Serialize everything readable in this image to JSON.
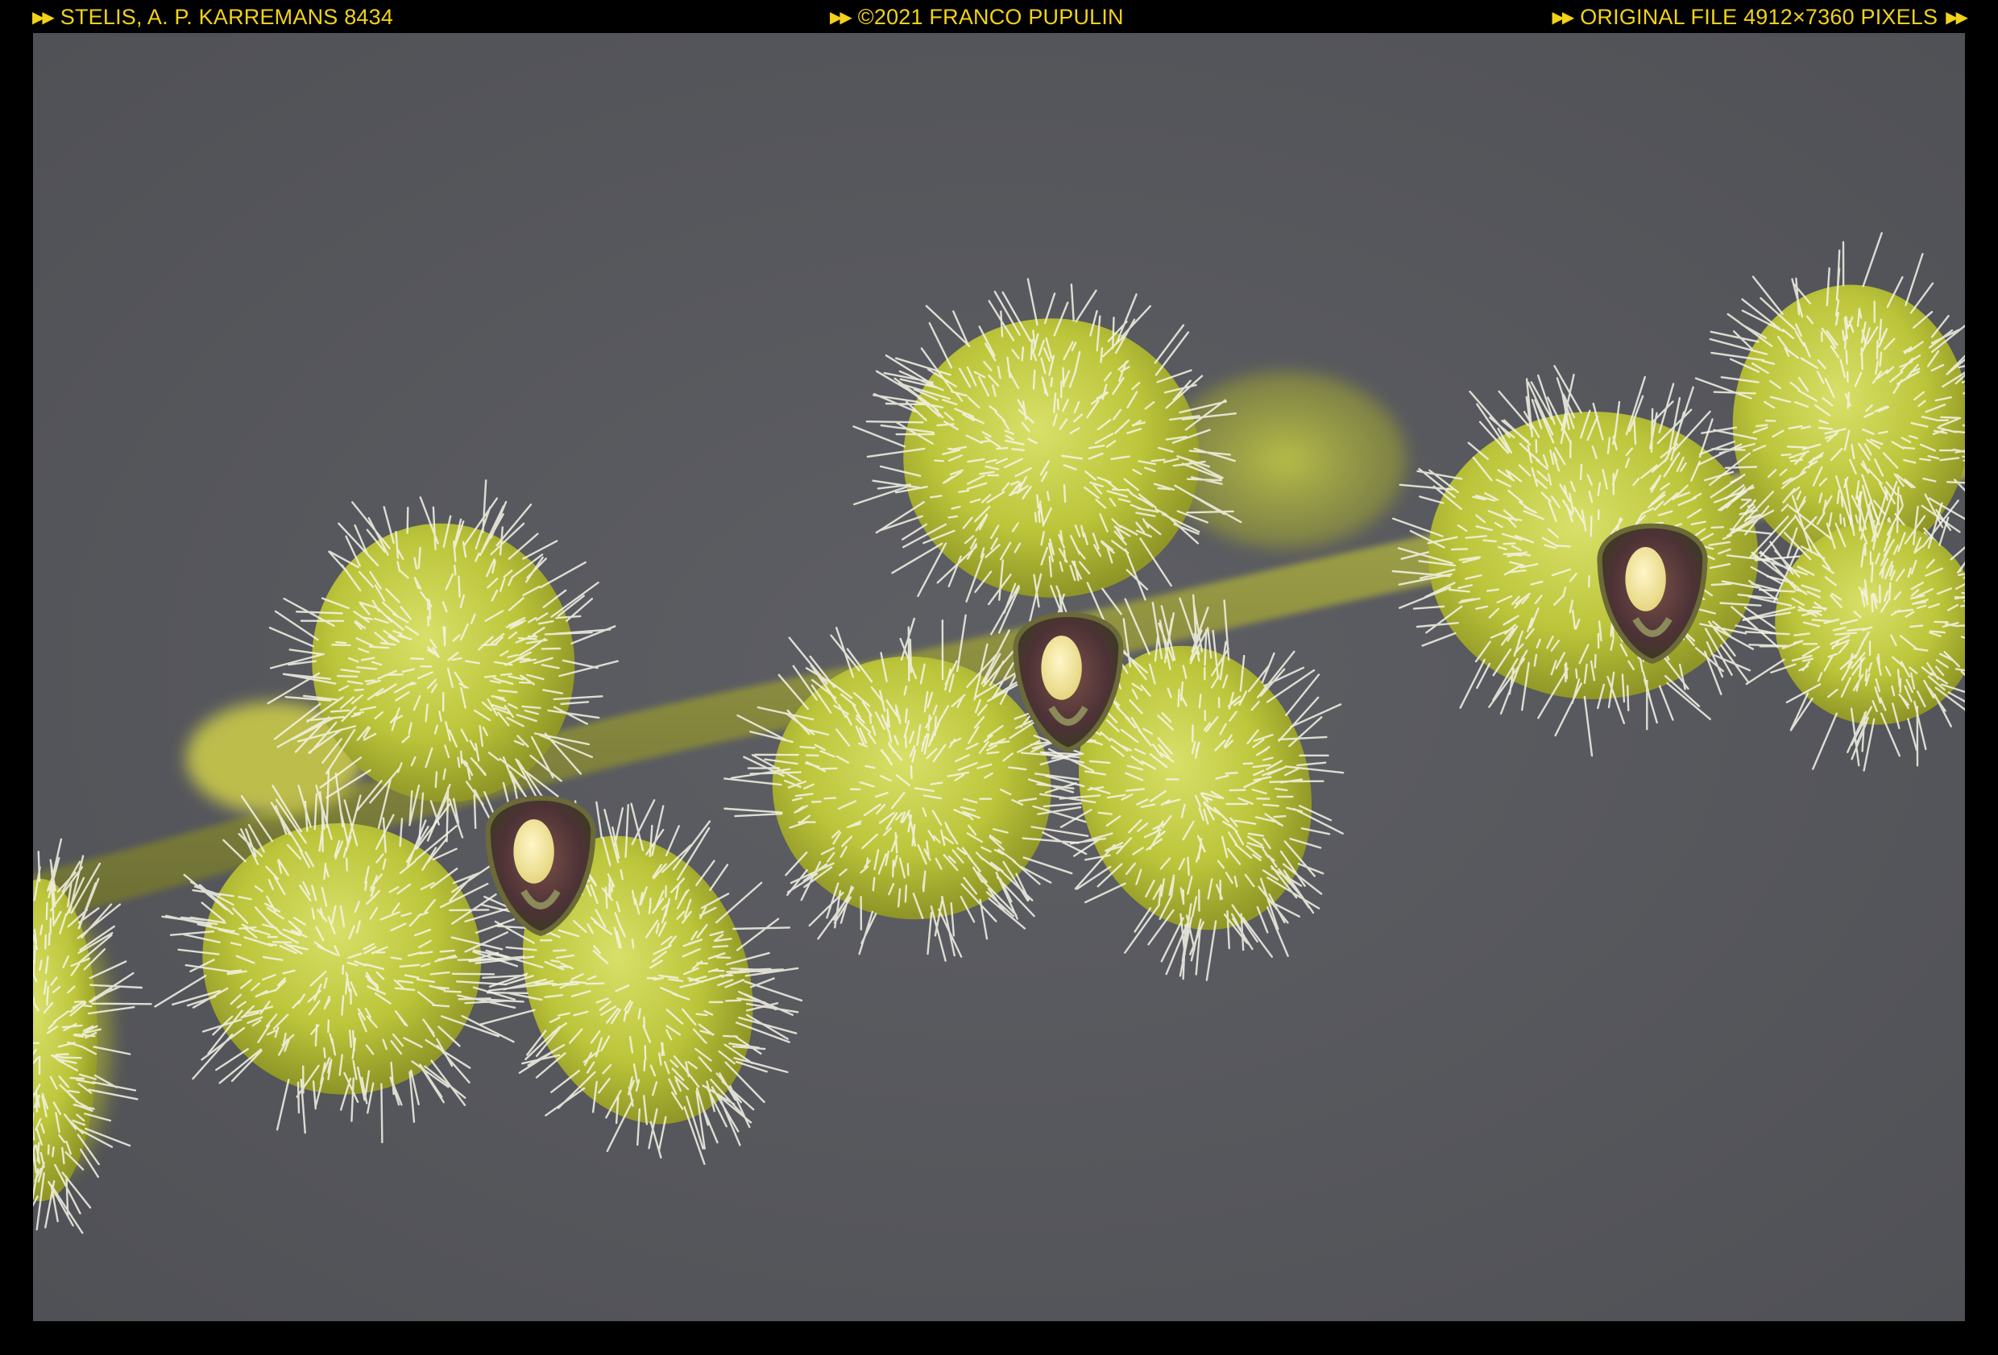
{
  "captions": {
    "left": "STELIS, A. P. KARREMANS 8434",
    "center": "©2021 FRANCO PUPULIN",
    "right": "ORIGINAL FILE 4912×7360 PIXELS"
  },
  "icons": {
    "arrow": "▶▶"
  },
  "colors": {
    "caption_text": "#f2d21a",
    "frame": "#000000",
    "background": "#5a5b60",
    "flower_green": "#c8d24a",
    "hair_white": "#f4f4e8",
    "center_purple": "#5a3a3e"
  }
}
